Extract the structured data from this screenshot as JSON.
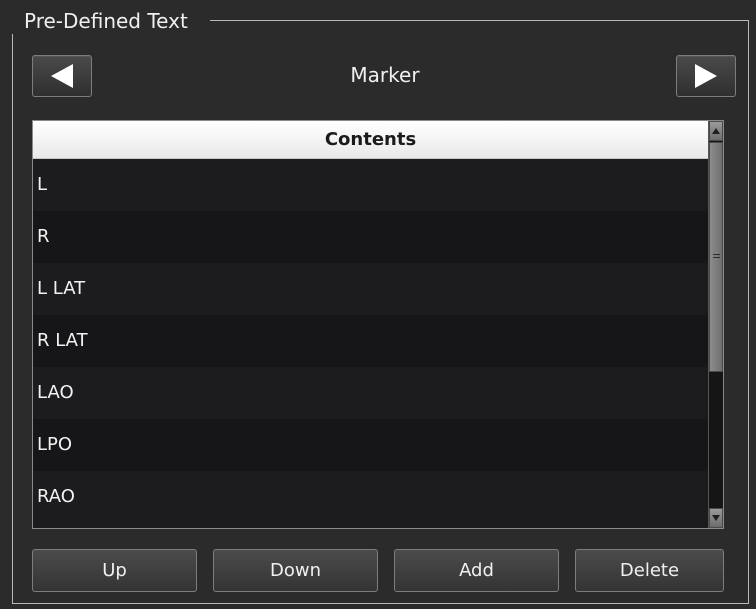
{
  "panel": {
    "title": "Pre-Defined Text"
  },
  "navigator": {
    "category": "Marker",
    "prev_icon": "left-triangle-icon",
    "next_icon": "right-triangle-icon"
  },
  "list": {
    "header": "Contents",
    "items": [
      "L",
      "R",
      "L LAT",
      "R LAT",
      "LAO",
      "LPO",
      "RAO"
    ]
  },
  "buttons": {
    "up": "Up",
    "down": "Down",
    "add": "Add",
    "delete": "Delete"
  },
  "colors": {
    "background": "#2b2b2b",
    "list_background": "#1c1c1f",
    "header_background": "#ffffff",
    "text": "#f0f0f0"
  }
}
